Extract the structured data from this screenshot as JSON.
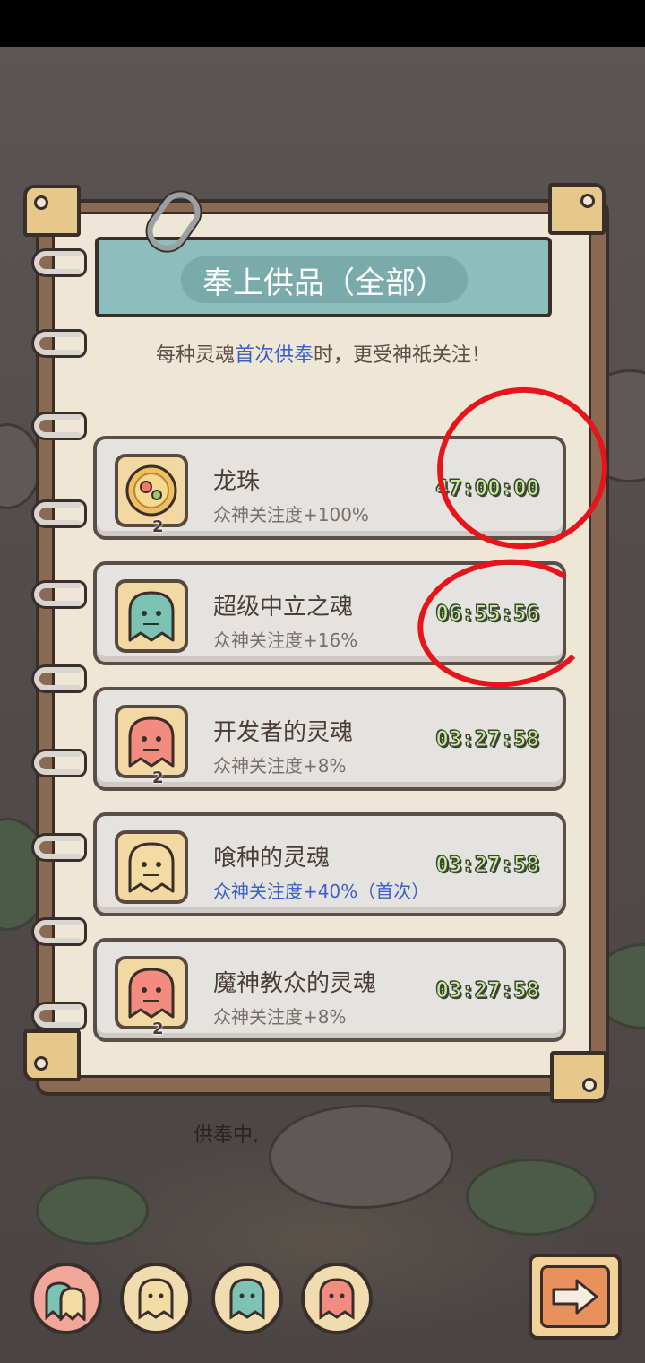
{
  "panel": {
    "title": "奉上供品（全部）",
    "subtitle_pre": "每种灵魂",
    "subtitle_highlight": "首次供奉",
    "subtitle_post": "时，更受神祇关注！"
  },
  "offerings": [
    {
      "name": "龙珠",
      "bonus": "众神关注度+100%",
      "time": "47:00:00",
      "count": "2",
      "icon": "dragon-orb-icon",
      "color": "#f0c060",
      "first": false
    },
    {
      "name": "超级中立之魂",
      "bonus": "众神关注度+16%",
      "time": "06:55:56",
      "count": "",
      "icon": "teal-ghost-icon",
      "color": "#7cc3b4",
      "first": false
    },
    {
      "name": "开发者的灵魂",
      "bonus": "众神关注度+8%",
      "time": "03:27:58",
      "count": "2",
      "icon": "red-ghost-icon",
      "color": "#f28b80",
      "first": false
    },
    {
      "name": "喰种的灵魂",
      "bonus": "众神关注度+40%（首次）",
      "time": "03:27:58",
      "count": "",
      "icon": "cream-ghost-icon",
      "color": "#f3dca4",
      "first": true
    },
    {
      "name": "魔神教众的灵魂",
      "bonus": "众神关注度+8%",
      "time": "03:27:58",
      "count": "2",
      "icon": "red-ghost-icon",
      "color": "#f28b80",
      "first": false
    }
  ],
  "status_text": "供奉中.",
  "bottom_bar": {
    "filters": [
      {
        "icon": "all-ghosts-icon",
        "active": true
      },
      {
        "icon": "cream-ghost-icon",
        "active": false
      },
      {
        "icon": "teal-ghost-icon",
        "active": false
      },
      {
        "icon": "red-ghost-icon",
        "active": false
      }
    ],
    "next_icon": "right-arrow-icon"
  }
}
